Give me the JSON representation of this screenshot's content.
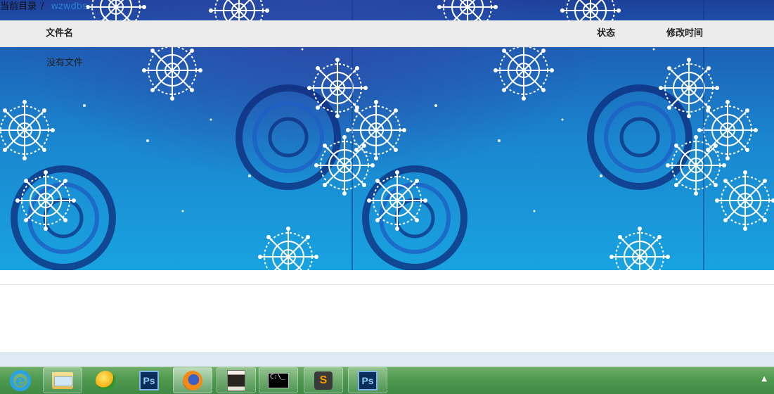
{
  "breadcrumb": {
    "root_label": "当前目录",
    "separator": "/",
    "current": "wzwdbs"
  },
  "file_table": {
    "columns": {
      "name": "文件名",
      "status": "状态",
      "modified": "修改时间"
    },
    "empty_message": "没有文件"
  },
  "taskbar": {
    "items": [
      {
        "icon": "internet-explorer-icon",
        "label": "e"
      },
      {
        "icon": "file-explorer-icon"
      },
      {
        "icon": "green-app-icon"
      },
      {
        "icon": "photoshop-icon",
        "label": "Ps"
      },
      {
        "icon": "firefox-icon",
        "active": true
      },
      {
        "icon": "photo-viewer-icon"
      },
      {
        "icon": "command-prompt-icon",
        "label": "C:\\_"
      },
      {
        "icon": "sublime-text-icon",
        "label": "S"
      },
      {
        "icon": "photoshop-icon",
        "label": "Ps"
      }
    ],
    "tray_arrow": "▲"
  },
  "colors": {
    "header_bg": "#ececec",
    "link": "#2a7fd4",
    "wallpaper_top": "#1d3f99",
    "wallpaper_bottom": "#19a3e0",
    "taskbar": "#4f9a4f"
  }
}
